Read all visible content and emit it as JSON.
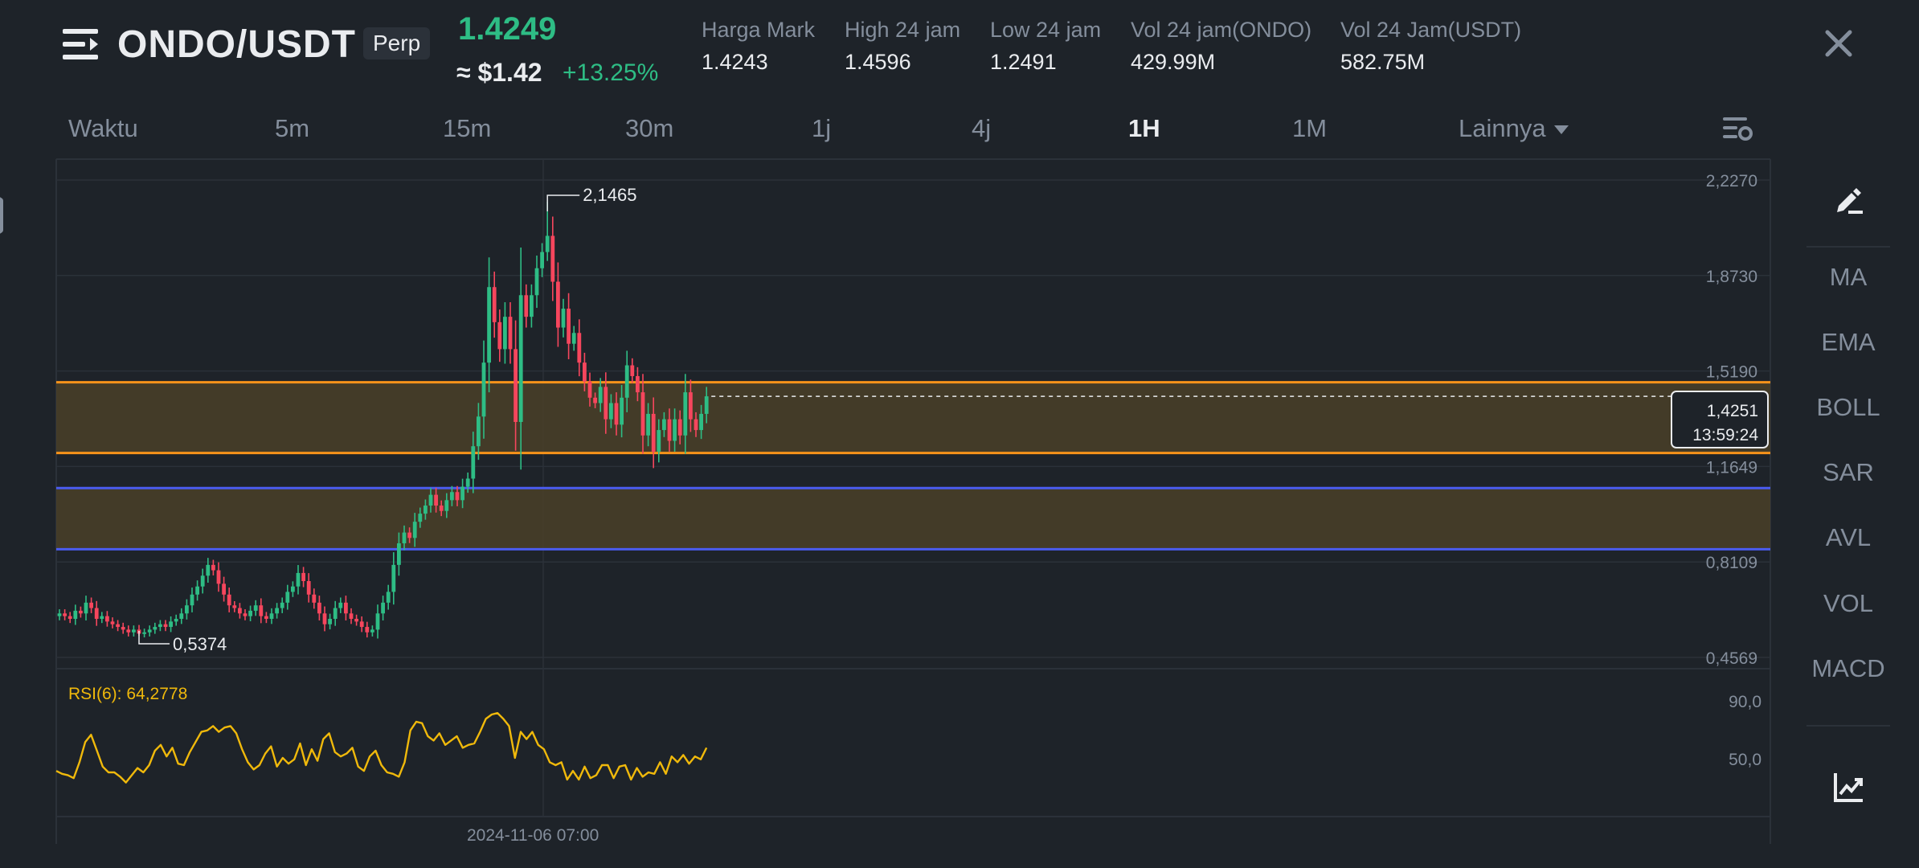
{
  "header": {
    "pair": "ONDO/USDT",
    "contract_type": "Perp",
    "last_price": "1.4249",
    "usd_price": "≈ $1.42",
    "change_percent": "+13.25%",
    "stats": [
      {
        "label": "Harga Mark",
        "value": "1.4243"
      },
      {
        "label": "High 24 jam",
        "value": "1.4596"
      },
      {
        "label": "Low 24 jam",
        "value": "1.2491"
      },
      {
        "label": "Vol 24 jam(ONDO)",
        "value": "429.99M"
      },
      {
        "label": "Vol 24 Jam(USDT)",
        "value": "582.75M"
      }
    ]
  },
  "timeframes": {
    "items": [
      "Waktu",
      "5m",
      "15m",
      "30m",
      "1j",
      "4j",
      "1H",
      "1M"
    ],
    "active": "1H",
    "more_label": "Lainnya"
  },
  "toolbar": {
    "indicators": [
      "MA",
      "EMA",
      "BOLL",
      "SAR",
      "AVL",
      "VOL",
      "MACD"
    ]
  },
  "icons": {
    "menu": "menu-icon",
    "close": "close-icon",
    "settings": "chart-settings-icon",
    "draw": "draw-pen-icon",
    "trend": "trend-chart-icon"
  },
  "colors": {
    "up": "#2ebd85",
    "down": "#f6465d",
    "rsi": "#f0b90b",
    "zone_orange": "#f7931a",
    "zone_blue": "#4a5cf0",
    "zone_fill": "#4a4028"
  },
  "chart_data": {
    "type": "candlestick",
    "instrument": "ONDO/USDT Perp",
    "interval": "1H",
    "price_axis_ticks": [
      "2,2270",
      "1,8730",
      "1,5190",
      "1,1649",
      "0,8109",
      "0,4569"
    ],
    "price_axis_values": [
      2.227,
      1.873,
      1.519,
      1.1649,
      0.8109,
      0.4569
    ],
    "ylim": [
      0.4569,
      2.227
    ],
    "high_marker": {
      "label": "2,1465",
      "value": 2.1465
    },
    "low_marker": {
      "label": "0,5374",
      "value": 0.5374
    },
    "current_price_label": "1,4251",
    "countdown": "13:59:24",
    "current_price": 1.4251,
    "zones": [
      {
        "color": "orange",
        "top": 1.477,
        "bottom": 1.215
      },
      {
        "color": "blue",
        "top": 1.085,
        "bottom": 0.858
      }
    ],
    "time_label": "2024-11-06 07:00",
    "closes": [
      0.62,
      0.61,
      0.6,
      0.63,
      0.62,
      0.66,
      0.64,
      0.6,
      0.61,
      0.59,
      0.58,
      0.57,
      0.56,
      0.55,
      0.56,
      0.545,
      0.55,
      0.56,
      0.57,
      0.58,
      0.57,
      0.59,
      0.6,
      0.62,
      0.65,
      0.69,
      0.72,
      0.76,
      0.8,
      0.78,
      0.73,
      0.69,
      0.65,
      0.64,
      0.62,
      0.61,
      0.63,
      0.65,
      0.61,
      0.6,
      0.62,
      0.64,
      0.66,
      0.7,
      0.72,
      0.77,
      0.74,
      0.69,
      0.66,
      0.62,
      0.58,
      0.6,
      0.64,
      0.66,
      0.62,
      0.6,
      0.59,
      0.57,
      0.55,
      0.56,
      0.62,
      0.66,
      0.7,
      0.8,
      0.88,
      0.92,
      0.9,
      0.96,
      0.99,
      1.02,
      1.06,
      1.02,
      1.0,
      1.04,
      1.07,
      1.04,
      1.09,
      1.12,
      1.24,
      1.35,
      1.55,
      1.83,
      1.7,
      1.6,
      1.72,
      1.6,
      1.33,
      1.8,
      1.72,
      1.8,
      1.9,
      1.96,
      2.02,
      1.85,
      1.68,
      1.75,
      1.62,
      1.66,
      1.55,
      1.48,
      1.42,
      1.4,
      1.46,
      1.34,
      1.4,
      1.32,
      1.42,
      1.54,
      1.5,
      1.44,
      1.28,
      1.36,
      1.22,
      1.3,
      1.34,
      1.26,
      1.34,
      1.28,
      1.44,
      1.34,
      1.3,
      1.36,
      1.4251
    ],
    "rsi_label": "RSI(6): 64,2778",
    "rsi_axis_ticks": [
      "90,0",
      "50,0"
    ],
    "rsi_values": [
      46,
      44,
      43,
      41,
      52,
      66,
      71,
      60,
      49,
      45,
      45,
      42,
      38,
      43,
      48,
      45,
      50,
      60,
      64,
      56,
      62,
      51,
      50,
      59,
      66,
      73,
      74,
      77,
      73,
      76,
      77,
      72,
      61,
      52,
      47,
      50,
      58,
      63,
      49,
      55,
      51,
      54,
      65,
      50,
      61,
      53,
      68,
      72,
      59,
      56,
      58,
      62,
      49,
      46,
      56,
      60,
      50,
      45,
      44,
      42,
      52,
      74,
      80,
      79,
      70,
      67,
      72,
      64,
      67,
      70,
      62,
      64,
      65,
      73,
      82,
      85,
      86,
      82,
      77,
      55,
      73,
      68,
      73,
      64,
      61,
      52,
      50,
      52,
      40,
      46,
      40,
      49,
      41,
      43,
      50,
      50,
      41,
      49,
      50,
      40,
      48,
      42,
      45,
      44,
      52,
      44,
      56,
      52,
      57,
      51,
      56,
      54,
      62
    ],
    "grid": true
  }
}
